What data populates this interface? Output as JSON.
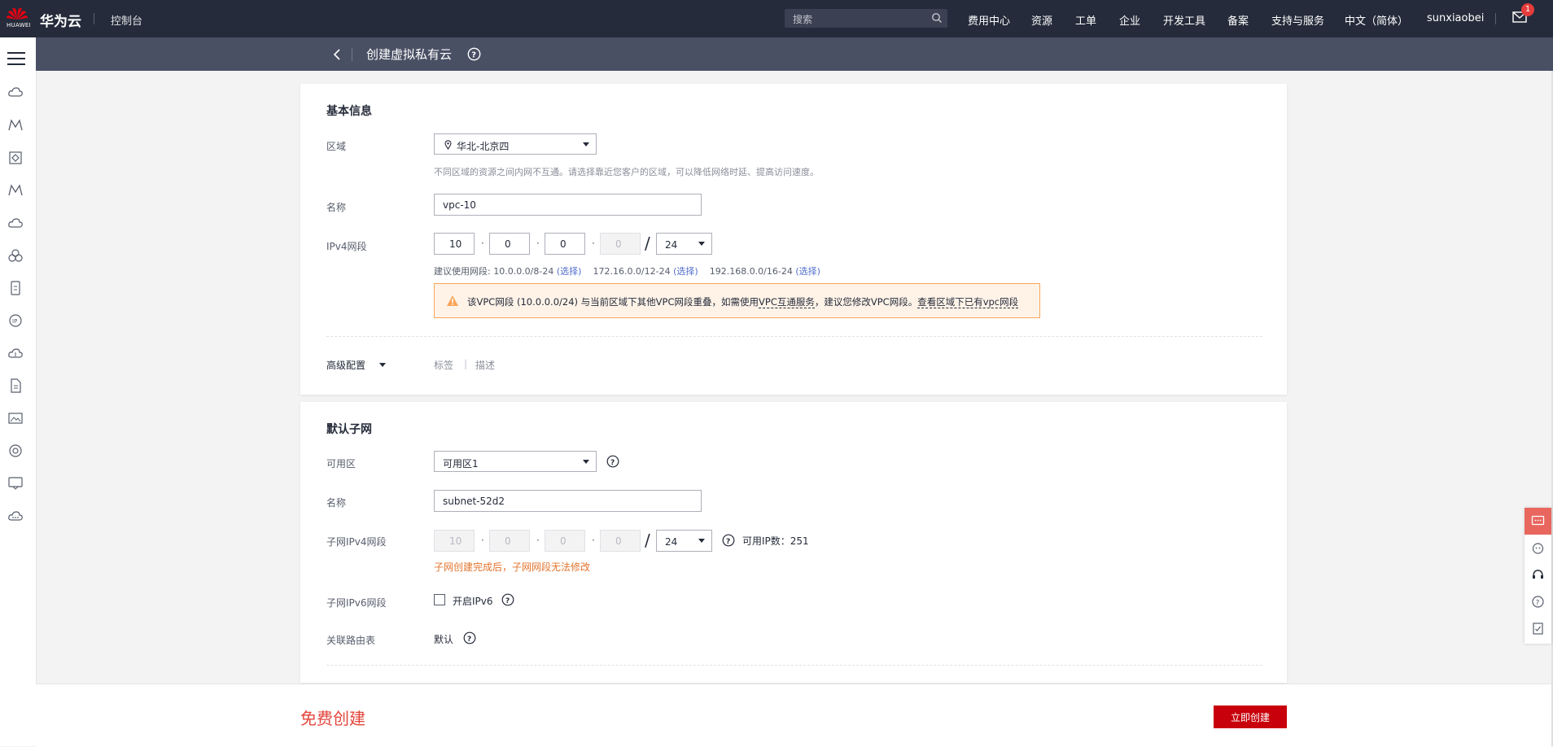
{
  "header": {
    "logo_text": "HUAWEI",
    "brand": "华为云",
    "console": "控制台",
    "search_placeholder": "搜索",
    "nav": [
      "费用中心",
      "资源",
      "工单",
      "企业",
      "开发工具",
      "备案",
      "支持与服务",
      "中文（简体）",
      "sunxiaobei"
    ],
    "mail_badge": "1"
  },
  "subheader": {
    "title": "创建虚拟私有云"
  },
  "basic": {
    "title": "基本信息",
    "region_label": "区域",
    "region_value": "华北-北京四",
    "region_hint": "不同区域的资源之间内网不互通。请选择靠近您客户的区域，可以降低网络时延、提高访问速度。",
    "name_label": "名称",
    "name_value": "vpc-10",
    "ipv4_label": "IPv4网段",
    "octets": [
      "10",
      "0",
      "0",
      "0"
    ],
    "mask": "24",
    "suggest_prefix": "建议使用网段: 10.0.0.0/8-24",
    "suggest_choose": "(选择)",
    "suggest_2": "172.16.0.0/12-24",
    "suggest_3": "192.168.0.0/16-24",
    "warn_text_1": "该VPC网段 (10.0.0.0/24) 与当前区域下其他VPC网段重叠，如需使用",
    "warn_link_1": "VPC互通服务",
    "warn_text_2": "，建议您修改VPC网段。",
    "warn_link_2": "查看区域下已有vpc网段",
    "advanced_label": "高级配置",
    "tag_link": "标签",
    "desc_link": "描述"
  },
  "subnet": {
    "title": "默认子网",
    "az_label": "可用区",
    "az_value": "可用区1",
    "name_label": "名称",
    "name_value": "subnet-52d2",
    "ipv4_label": "子网IPv4网段",
    "octets": [
      "10",
      "0",
      "0",
      "0"
    ],
    "mask": "24",
    "available_ips": "可用IP数：251",
    "warning": "子网创建完成后，子网网段无法修改",
    "ipv6_label": "子网IPv6网段",
    "ipv6_checkbox": "开启IPv6",
    "route_label": "关联路由表",
    "route_value": "默认"
  },
  "footer": {
    "free_label": "免费创建",
    "create_button": "立即创建"
  },
  "colors": {
    "topbar": "#252b3a",
    "subheader": "#4a5064",
    "brand_red": "#c7000b",
    "warning_orange": "#e3742d"
  }
}
